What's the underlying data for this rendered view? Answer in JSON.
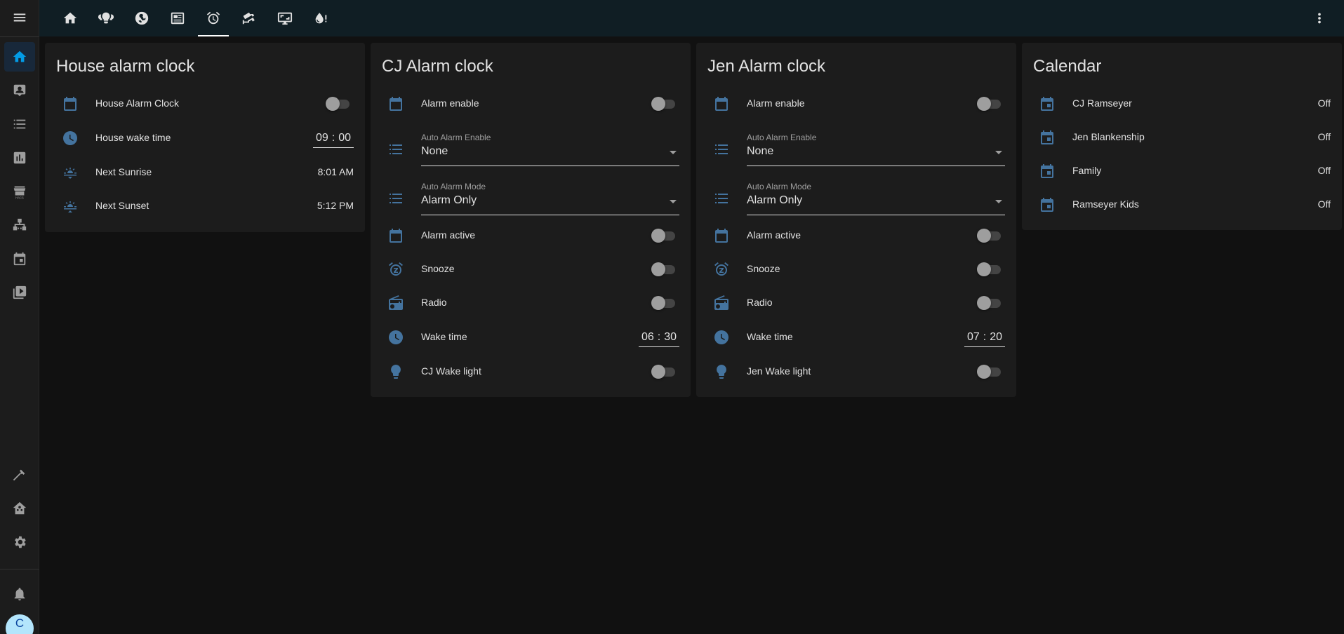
{
  "sidebar": {
    "items": [
      {
        "name": "sidebar-item-overview",
        "icon": "home-icon",
        "active": true
      },
      {
        "name": "sidebar-item-dashboard",
        "icon": "account-box-icon"
      },
      {
        "name": "sidebar-item-list",
        "icon": "list-icon"
      },
      {
        "name": "sidebar-item-history",
        "icon": "bar-chart-icon"
      },
      {
        "name": "sidebar-item-hacs",
        "icon": "store-icon",
        "caption": "HACS"
      },
      {
        "name": "sidebar-item-network",
        "icon": "sitemap-icon"
      },
      {
        "name": "sidebar-item-calendar",
        "icon": "calendar-icon"
      },
      {
        "name": "sidebar-item-media",
        "icon": "play-box-icon"
      },
      {
        "name": "sidebar-item-developer",
        "icon": "hammer-icon"
      },
      {
        "name": "sidebar-item-supervisor",
        "icon": "home-assistant-icon"
      },
      {
        "name": "sidebar-item-settings",
        "icon": "gear-icon"
      },
      {
        "name": "sidebar-item-notifications",
        "icon": "bell-icon"
      }
    ],
    "user_initial": "C"
  },
  "topbar": {
    "tabs": [
      {
        "icon": "home-icon"
      },
      {
        "icon": "lightbulb-group-icon"
      },
      {
        "icon": "radiator-icon"
      },
      {
        "icon": "newspaper-icon"
      },
      {
        "icon": "alarm-icon",
        "active": true
      },
      {
        "icon": "cctv-icon"
      },
      {
        "icon": "monitor-icon"
      },
      {
        "icon": "water-alert-icon"
      }
    ]
  },
  "cards": {
    "house": {
      "title": "House alarm clock",
      "rows": {
        "clock": {
          "label": "House Alarm Clock",
          "state": "off"
        },
        "wake": {
          "label": "House wake time",
          "hour": "09",
          "minute": "00"
        },
        "sunrise": {
          "label": "Next Sunrise",
          "value": "8:01 AM"
        },
        "sunset": {
          "label": "Next Sunset",
          "value": "5:12 PM"
        }
      }
    },
    "cj": {
      "title": "CJ Alarm clock",
      "rows": {
        "enable": {
          "label": "Alarm enable",
          "state": "off"
        },
        "auto_enable": {
          "label": "Auto Alarm Enable",
          "value": "None"
        },
        "auto_mode": {
          "label": "Auto Alarm Mode",
          "value": "Alarm Only"
        },
        "active": {
          "label": "Alarm active",
          "state": "off"
        },
        "snooze": {
          "label": "Snooze",
          "state": "off"
        },
        "radio": {
          "label": "Radio",
          "state": "off"
        },
        "wake": {
          "label": "Wake time",
          "hour": "06",
          "minute": "30"
        },
        "light": {
          "label": "CJ Wake light",
          "state": "off"
        }
      }
    },
    "jen": {
      "title": "Jen Alarm clock",
      "rows": {
        "enable": {
          "label": "Alarm enable",
          "state": "off"
        },
        "auto_enable": {
          "label": "Auto Alarm Enable",
          "value": "None"
        },
        "auto_mode": {
          "label": "Auto Alarm Mode",
          "value": "Alarm Only"
        },
        "active": {
          "label": "Alarm active",
          "state": "off"
        },
        "snooze": {
          "label": "Snooze",
          "state": "off"
        },
        "radio": {
          "label": "Radio",
          "state": "off"
        },
        "wake": {
          "label": "Wake time",
          "hour": "07",
          "minute": "20"
        },
        "light": {
          "label": "Jen Wake light",
          "state": "off"
        }
      }
    },
    "calendar": {
      "title": "Calendar",
      "rows": [
        {
          "label": "CJ Ramseyer",
          "value": "Off"
        },
        {
          "label": "Jen Blankenship",
          "value": "Off"
        },
        {
          "label": "Family",
          "value": "Off"
        },
        {
          "label": "Ramseyer Kids",
          "value": "Off"
        }
      ]
    }
  },
  "colors": {
    "accent": "#039be5",
    "icon": "#44739e",
    "card": "#1c1c1c",
    "background": "#111111",
    "header": "#101e24"
  }
}
